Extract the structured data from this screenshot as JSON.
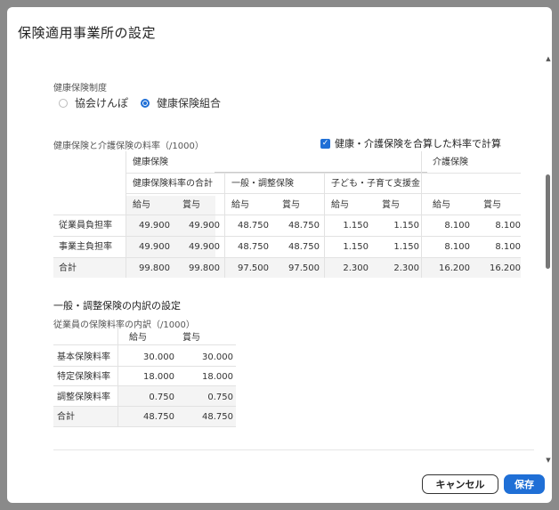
{
  "dialog": {
    "title": "保険適用事業所の設定"
  },
  "health_system": {
    "label": "健康保険制度",
    "options": [
      {
        "label": "協会けんぽ",
        "selected": false
      },
      {
        "label": "健康保険組合",
        "selected": true
      }
    ]
  },
  "rates": {
    "label": "健康保険と介護保険の料率（/1000）",
    "combine_checkbox": {
      "label": "健康・介護保険を合算した料率で計算",
      "checked": true
    },
    "groups": {
      "health": "健康保険",
      "health_total": "健康保険料率の合計",
      "general": "一般・調整保険",
      "child": "子ども・子育て支援金",
      "care": "介護保険"
    },
    "col_salary": "給与",
    "col_bonus": "賞与",
    "rows": [
      {
        "label": "従業員負担率",
        "values": [
          "49.900",
          "49.900",
          "48.750",
          "48.750",
          "1.150",
          "1.150",
          "8.100",
          "8.100"
        ]
      },
      {
        "label": "事業主負担率",
        "values": [
          "49.900",
          "49.900",
          "48.750",
          "48.750",
          "1.150",
          "1.150",
          "8.100",
          "8.100"
        ]
      },
      {
        "label": "合計",
        "values": [
          "99.800",
          "99.800",
          "97.500",
          "97.500",
          "2.300",
          "2.300",
          "16.200",
          "16.200"
        ]
      }
    ]
  },
  "breakdown": {
    "title": "一般・調整保険の内訳の設定",
    "label": "従業員の保険料率の内訳（/1000）",
    "col_salary": "給与",
    "col_bonus": "賞与",
    "rows": [
      {
        "label": "基本保険料率",
        "values": [
          "30.000",
          "30.000"
        ]
      },
      {
        "label": "特定保険料率",
        "values": [
          "18.000",
          "18.000"
        ]
      },
      {
        "label": "調整保険料率",
        "values": [
          "0.750",
          "0.750"
        ]
      },
      {
        "label": "合計",
        "values": [
          "48.750",
          "48.750"
        ]
      }
    ]
  },
  "scrollbar": {
    "up": "▲",
    "down": "▼"
  },
  "footer": {
    "cancel": "キャンセル",
    "save": "保存"
  },
  "colors": {
    "accent": "#1f6fd6"
  }
}
